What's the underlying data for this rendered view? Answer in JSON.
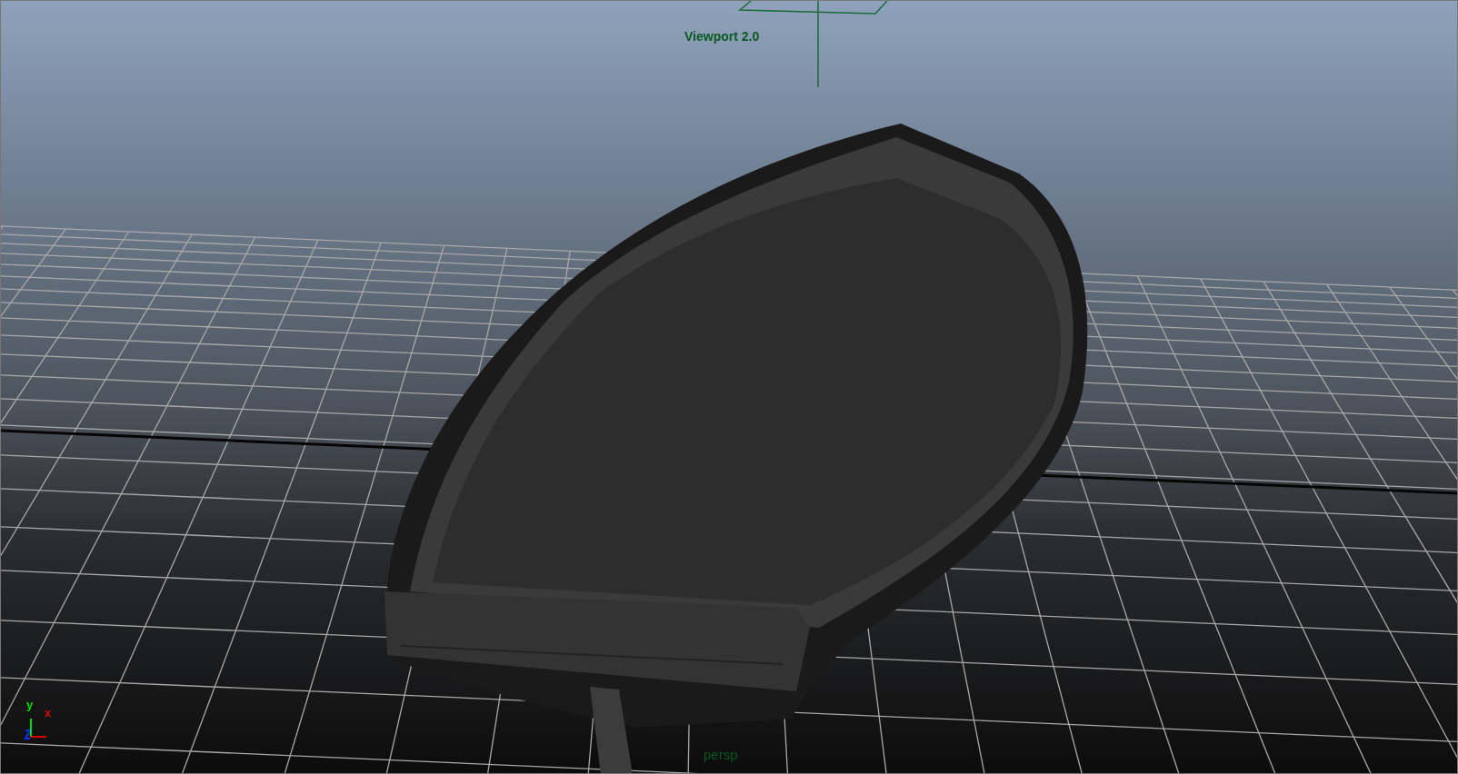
{
  "viewport": {
    "renderer_label": "Viewport 2.0",
    "camera_label": "persp",
    "axes": [
      {
        "label": "y",
        "color": "#00e000"
      },
      {
        "label": "x",
        "color": "#e00000"
      }
    ]
  }
}
